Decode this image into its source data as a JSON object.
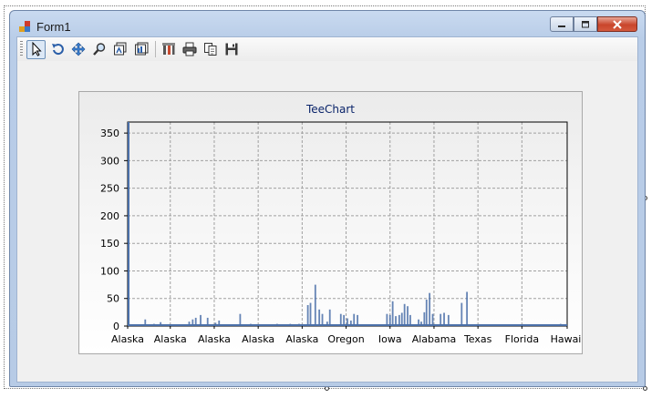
{
  "window": {
    "title": "Form1",
    "icon": "form-icon"
  },
  "caption_buttons": [
    "minimize-icon",
    "maximize-icon",
    "close-icon"
  ],
  "toolbar": {
    "buttons": [
      {
        "name": "pointer",
        "icon": "cursor-arrow-icon",
        "active": true
      },
      {
        "name": "rotate",
        "icon": "rotate-icon"
      },
      {
        "name": "move",
        "icon": "move-icon"
      },
      {
        "name": "zoom",
        "icon": "magnifier-icon"
      },
      {
        "name": "3d",
        "icon": "3d-depth-icon"
      },
      {
        "name": "view-3d",
        "icon": "3d-view-icon"
      },
      {
        "name": "edit",
        "icon": "editor-icon"
      },
      {
        "name": "print",
        "icon": "printer-icon"
      },
      {
        "name": "copy",
        "icon": "copy-icon"
      },
      {
        "name": "save",
        "icon": "floppy-disk-icon"
      }
    ]
  },
  "colors": {
    "series": "#4a6fa8",
    "title": "#0a246a"
  },
  "chart_data": {
    "type": "bar",
    "title": "TeeChart",
    "ylim": [
      0,
      370
    ],
    "yticks": [
      0,
      50,
      100,
      150,
      200,
      250,
      300,
      350
    ],
    "xlim": [
      0,
      100
    ],
    "xtick_labels": [
      {
        "x": 0,
        "label": "Alaska"
      },
      {
        "x": 9.7,
        "label": "Alaska"
      },
      {
        "x": 19.7,
        "label": "Alaska"
      },
      {
        "x": 29.7,
        "label": "Alaska"
      },
      {
        "x": 39.7,
        "label": "Alaska"
      },
      {
        "x": 49.7,
        "label": "Oregon"
      },
      {
        "x": 59.7,
        "label": "Iowa"
      },
      {
        "x": 69.7,
        "label": "Alabama"
      },
      {
        "x": 79.7,
        "label": "Texas"
      },
      {
        "x": 89.7,
        "label": "Florida"
      },
      {
        "x": 100,
        "label": "Hawaii"
      }
    ],
    "grid": true,
    "legend": "none",
    "points": [
      {
        "x": 0.2,
        "y": 370
      },
      {
        "x": 4,
        "y": 12
      },
      {
        "x": 6,
        "y": 4
      },
      {
        "x": 7.5,
        "y": 7
      },
      {
        "x": 14,
        "y": 8
      },
      {
        "x": 14.8,
        "y": 12
      },
      {
        "x": 15.5,
        "y": 15
      },
      {
        "x": 16.6,
        "y": 20
      },
      {
        "x": 18.2,
        "y": 15
      },
      {
        "x": 20,
        "y": 6
      },
      {
        "x": 20.8,
        "y": 10
      },
      {
        "x": 25.6,
        "y": 22
      },
      {
        "x": 28,
        "y": 4
      },
      {
        "x": 34,
        "y": 4
      },
      {
        "x": 37,
        "y": 4
      },
      {
        "x": 39,
        "y": 4
      },
      {
        "x": 41,
        "y": 38
      },
      {
        "x": 41.6,
        "y": 42
      },
      {
        "x": 42.7,
        "y": 75
      },
      {
        "x": 43.6,
        "y": 30
      },
      {
        "x": 44.3,
        "y": 22
      },
      {
        "x": 45.4,
        "y": 8
      },
      {
        "x": 46,
        "y": 30
      },
      {
        "x": 48.5,
        "y": 22
      },
      {
        "x": 49.2,
        "y": 20
      },
      {
        "x": 50,
        "y": 14
      },
      {
        "x": 50.8,
        "y": 10
      },
      {
        "x": 51.5,
        "y": 22
      },
      {
        "x": 52.3,
        "y": 20
      },
      {
        "x": 59,
        "y": 22
      },
      {
        "x": 59.7,
        "y": 20
      },
      {
        "x": 60.3,
        "y": 45
      },
      {
        "x": 61,
        "y": 18
      },
      {
        "x": 61.8,
        "y": 20
      },
      {
        "x": 62.4,
        "y": 24
      },
      {
        "x": 63,
        "y": 40
      },
      {
        "x": 63.7,
        "y": 36
      },
      {
        "x": 64.3,
        "y": 20
      },
      {
        "x": 66.2,
        "y": 12
      },
      {
        "x": 66.8,
        "y": 8
      },
      {
        "x": 67.5,
        "y": 25
      },
      {
        "x": 68,
        "y": 48
      },
      {
        "x": 68.7,
        "y": 60
      },
      {
        "x": 69.4,
        "y": 22
      },
      {
        "x": 71.2,
        "y": 22
      },
      {
        "x": 72,
        "y": 24
      },
      {
        "x": 73,
        "y": 20
      },
      {
        "x": 76,
        "y": 42
      },
      {
        "x": 77.2,
        "y": 62
      },
      {
        "x": 98.5,
        "y": 4
      }
    ]
  }
}
